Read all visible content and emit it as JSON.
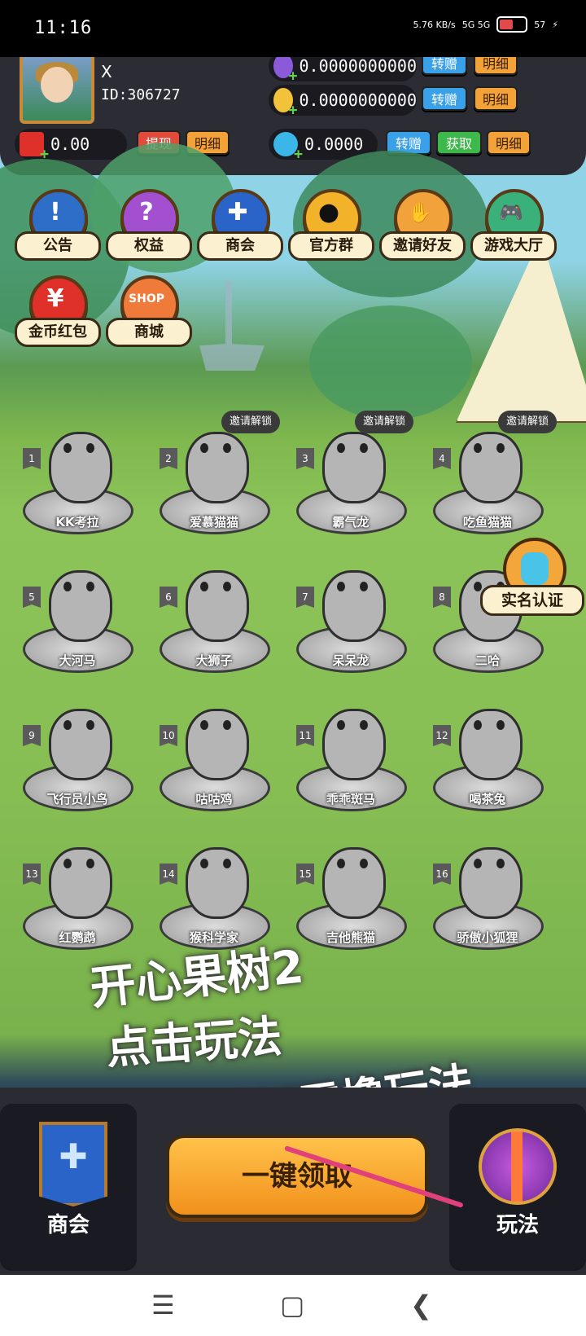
{
  "status": {
    "time": "11:16",
    "speed": "5.76 KB/s",
    "network": "5G 5G",
    "battery": "57"
  },
  "user": {
    "name": "X",
    "id": "ID:306727"
  },
  "wallet": {
    "diamond": "0.0000000000",
    "gold": "0.0000000000",
    "redpacket": "0.00",
    "gem": "0.0000"
  },
  "buttons": {
    "transfer": "转赠",
    "detail": "明细",
    "withdraw": "提现",
    "obtain": "获取"
  },
  "menu": [
    {
      "label": "公告",
      "icon": "announcement-icon",
      "glyph": "!"
    },
    {
      "label": "权益",
      "icon": "rights-icon",
      "glyph": "?"
    },
    {
      "label": "商会",
      "icon": "guild-icon",
      "glyph": "✚"
    },
    {
      "label": "官方群",
      "icon": "qq-icon",
      "glyph": "●"
    },
    {
      "label": "邀请好友",
      "icon": "handshake-icon",
      "glyph": "✋"
    },
    {
      "label": "游戏大厅",
      "icon": "gamepad-icon",
      "glyph": "🎮"
    },
    {
      "label": "金币红包",
      "icon": "coin-redpacket-icon",
      "glyph": "¥"
    },
    {
      "label": "商城",
      "icon": "shop-icon",
      "glyph": "SHOP"
    }
  ],
  "unlock_label": "邀请解锁",
  "animals": [
    {
      "num": "1",
      "name": "KK考拉"
    },
    {
      "num": "2",
      "name": "爱慕猫猫"
    },
    {
      "num": "3",
      "name": "霸气龙"
    },
    {
      "num": "4",
      "name": "吃鱼猫猫"
    },
    {
      "num": "5",
      "name": "大河马"
    },
    {
      "num": "6",
      "name": "大狮子"
    },
    {
      "num": "7",
      "name": "呆呆龙"
    },
    {
      "num": "8",
      "name": "二哈"
    },
    {
      "num": "9",
      "name": "飞行员小鸟"
    },
    {
      "num": "10",
      "name": "咕咕鸡"
    },
    {
      "num": "11",
      "name": "乖乖斑马"
    },
    {
      "num": "12",
      "name": "喝茶兔"
    },
    {
      "num": "13",
      "name": "红鹦鹉"
    },
    {
      "num": "14",
      "name": "猴科学家"
    },
    {
      "num": "15",
      "name": "吉他熊猫"
    },
    {
      "num": "16",
      "name": "骄傲小狐狸"
    }
  ],
  "realname": "实名认证",
  "overlay_text": {
    "line1": "开心果树2",
    "line2": "点击玩法",
    "line3": "了解详细零撸玩法"
  },
  "bottom": {
    "guild": "商会",
    "claim": "一键领取",
    "play": "玩法"
  },
  "colors": {
    "accent": "#f3a23a",
    "blue": "#3aa0e8",
    "arrow": "#e2407a"
  }
}
